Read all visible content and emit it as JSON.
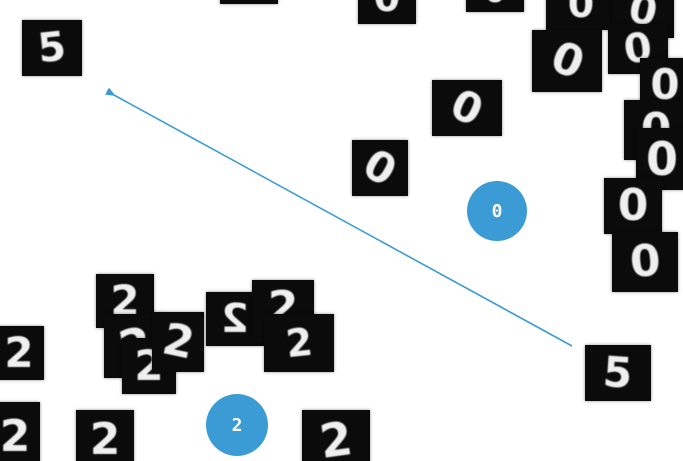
{
  "accent_color": "#3a9bd5",
  "tile_color": "#0b0b0b",
  "digit_color": "#efefef",
  "arrow": {
    "color": "#3a9bd5",
    "icon": "arrow-icon"
  },
  "clusters": [
    {
      "label": "0",
      "digit": "0",
      "icon": "cluster-badge"
    },
    {
      "label": "2",
      "digit": "2",
      "icon": "cluster-badge"
    }
  ],
  "samples": {
    "arrow_source": "5",
    "arrow_target": "5"
  }
}
